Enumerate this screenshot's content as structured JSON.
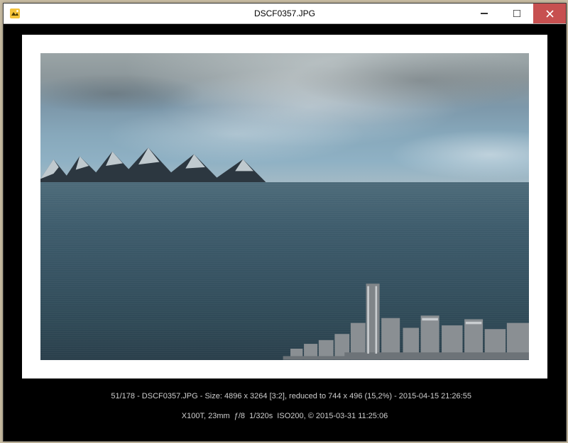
{
  "titlebar": {
    "filename": "DSCF0357.JPG"
  },
  "status": {
    "line1": "51/178 - DSCF0357.JPG - Size: 4896 x 3264 [3:2], reduced to 744 x 496 (15,2%) - 2015-04-15 21:26:55",
    "line2": "X100T, 23mm  ƒ/8  1/320s  ISO200, © 2015-03-31 11:25:06"
  }
}
